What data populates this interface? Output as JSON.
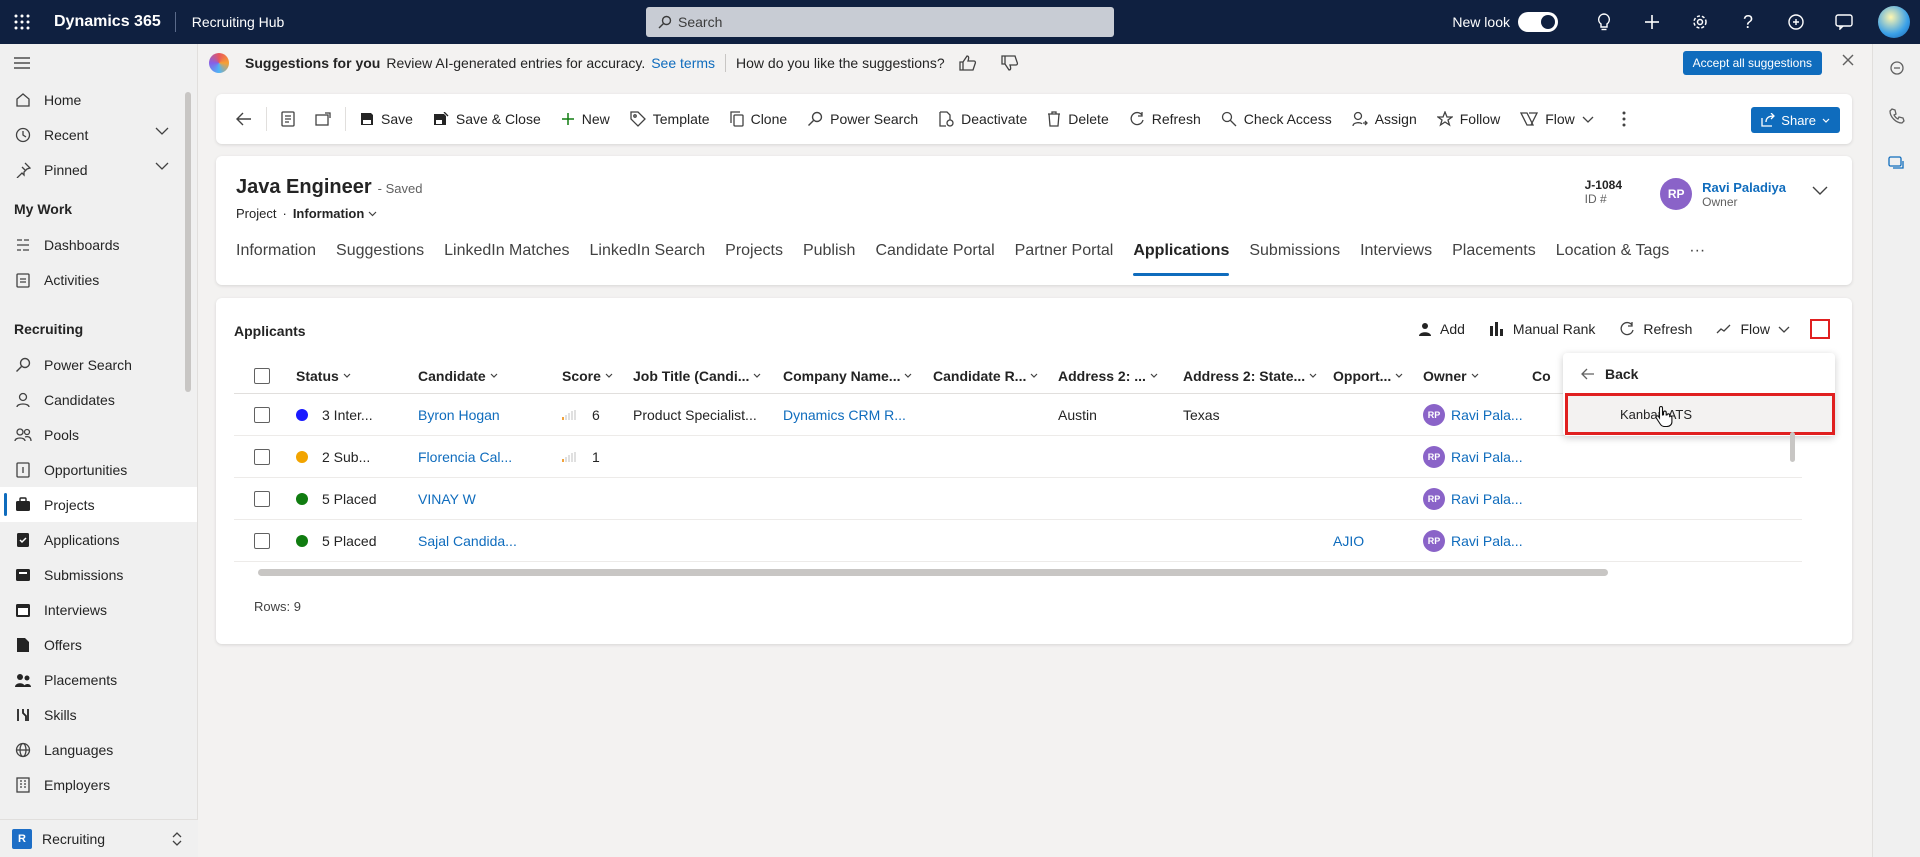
{
  "topbar": {
    "app_name": "Dynamics 365",
    "hub_name": "Recruiting Hub",
    "search_placeholder": "Search",
    "new_look_label": "New look"
  },
  "nav": {
    "items_top": [
      {
        "label": "Home",
        "icon": "home-icon"
      },
      {
        "label": "Recent",
        "icon": "clock-icon"
      },
      {
        "label": "Pinned",
        "icon": "pin-icon"
      }
    ],
    "group_mywork": "My Work",
    "items_mywork": [
      {
        "label": "Dashboards",
        "icon": "dashboard-icon"
      },
      {
        "label": "Activities",
        "icon": "activities-icon"
      }
    ],
    "group_recruiting": "Recruiting",
    "items_recruiting": [
      {
        "label": "Power Search",
        "icon": "search-icon"
      },
      {
        "label": "Candidates",
        "icon": "person-icon"
      },
      {
        "label": "Pools",
        "icon": "people-icon"
      },
      {
        "label": "Opportunities",
        "icon": "document-icon"
      },
      {
        "label": "Projects",
        "icon": "briefcase-icon"
      },
      {
        "label": "Applications",
        "icon": "clipboard-check-icon"
      },
      {
        "label": "Submissions",
        "icon": "submissions-icon"
      },
      {
        "label": "Interviews",
        "icon": "calendar-icon"
      },
      {
        "label": "Offers",
        "icon": "offer-icon"
      },
      {
        "label": "Placements",
        "icon": "placements-icon"
      },
      {
        "label": "Skills",
        "icon": "skills-icon"
      },
      {
        "label": "Languages",
        "icon": "globe-icon"
      },
      {
        "label": "Employers",
        "icon": "building-icon"
      }
    ],
    "area_badge": "R",
    "area_label": "Recruiting"
  },
  "suggestions": {
    "title": "Suggestions for you",
    "text": "Review AI-generated entries for accuracy.",
    "terms_link": "See terms",
    "question": "How do you like the suggestions?",
    "accept_all": "Accept all suggestions"
  },
  "commands": {
    "save": "Save",
    "save_close": "Save & Close",
    "new": "New",
    "template": "Template",
    "clone": "Clone",
    "power_search": "Power Search",
    "deactivate": "Deactivate",
    "delete": "Delete",
    "refresh": "Refresh",
    "check_access": "Check Access",
    "assign": "Assign",
    "follow": "Follow",
    "flow": "Flow",
    "share": "Share"
  },
  "record": {
    "title": "Java Engineer",
    "saved_status": "- Saved",
    "entity": "Project",
    "dot": "·",
    "form": "Information",
    "id_value": "J-1084",
    "id_label": "ID #",
    "owner_initials": "RP",
    "owner_name": "Ravi Paladiya",
    "owner_role": "Owner",
    "tabs": [
      "Information",
      "Suggestions",
      "LinkedIn Matches",
      "LinkedIn Search",
      "Projects",
      "Publish",
      "Candidate Portal",
      "Partner Portal",
      "Applications",
      "Submissions",
      "Interviews",
      "Placements",
      "Location & Tags"
    ],
    "more_tabs": "···"
  },
  "grid": {
    "title": "Applicants",
    "commands": {
      "add": "Add",
      "manual_rank": "Manual Rank",
      "refresh": "Refresh",
      "flow": "Flow"
    },
    "columns": [
      "Status",
      "Candidate",
      "Score",
      "Job Title (Candi...",
      "Company Name...",
      "Candidate R...",
      "Address 2: ...",
      "Address 2: State...",
      "Opport...",
      "Owner",
      "Co"
    ],
    "rows": [
      {
        "status_color": "#1a1aff",
        "status": "3 Inter...",
        "candidate": "Byron Hogan",
        "score_bars": 1,
        "score": "6",
        "job_title": "Product Specialist...",
        "company": "Dynamics CRM R...",
        "city": "Austin",
        "state": "Texas",
        "opportunity": "",
        "owner_initials": "RP",
        "owner": "Ravi Pala..."
      },
      {
        "status_color": "#f2a400",
        "status": "2 Sub...",
        "candidate": "Florencia Cal...",
        "score_bars": 1,
        "score": "1",
        "job_title": "",
        "company": "",
        "city": "",
        "state": "",
        "opportunity": "",
        "owner_initials": "RP",
        "owner": "Ravi Pala..."
      },
      {
        "status_color": "#107c10",
        "status": "5 Placed",
        "candidate": "VINAY W",
        "score_bars": 0,
        "score": "",
        "job_title": "",
        "company": "",
        "city": "",
        "state": "",
        "opportunity": "",
        "owner_initials": "RP",
        "owner": "Ravi Pala..."
      },
      {
        "status_color": "#107c10",
        "status": "5 Placed",
        "candidate": "Sajal Candida...",
        "score_bars": 0,
        "score": "",
        "job_title": "",
        "company": "",
        "city": "",
        "state": "",
        "opportunity": "AJIO",
        "owner_initials": "RP",
        "owner": "Ravi Pala..."
      }
    ],
    "rows_count": "Rows: 9"
  },
  "flyout": {
    "back": "Back",
    "item": "Kanban ATS"
  }
}
